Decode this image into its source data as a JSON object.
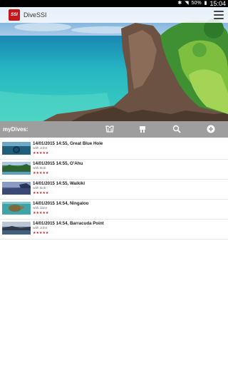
{
  "status_bar": {
    "battery": "50%",
    "time": "15:04"
  },
  "app_bar": {
    "title": "DiveSSI",
    "logo_text": "SSI"
  },
  "toolbar": {
    "title": "myDives:",
    "icons": [
      "wetsuit-icon",
      "dive-site-icon",
      "search-icon",
      "add-icon"
    ]
  },
  "dives": [
    {
      "title": "14/01/2015 14:55, Great Blue Hole",
      "buddy": "with John",
      "rating": "★★★★★",
      "thumb": "reef"
    },
    {
      "title": "14/01/2015 14:55, O'Ahu",
      "buddy": "with Bob",
      "rating": "★★★★★",
      "thumb": "island"
    },
    {
      "title": "14/01/2015 14:55, Waikiki",
      "buddy": "with Bob",
      "rating": "★★★★★",
      "thumb": "beach"
    },
    {
      "title": "14/01/2015 14:54, Ningaloo",
      "buddy": "with Jane",
      "rating": "★★★★★",
      "thumb": "turtle"
    },
    {
      "title": "14/01/2015 14:54, Barracuda Point",
      "buddy": "with John",
      "rating": "★★★★★",
      "thumb": "coast"
    }
  ],
  "colors": {
    "brand_red": "#c8161d",
    "toolbar_gray": "#9e9e9e",
    "star_red": "#c0282d"
  }
}
